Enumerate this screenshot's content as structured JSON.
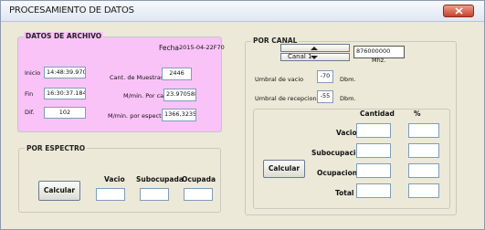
{
  "window": {
    "title": "PROCESAMIENTO DE DATOS"
  },
  "archivo": {
    "title": "DATOS DE ARCHIVO",
    "fecha_label": "Fecha",
    "fecha_value": "2015-04-22F70",
    "inicio_label": "Inicio",
    "inicio_value": "14:48:39.970",
    "fin_label": "Fin",
    "fin_value": "16:30:37.184",
    "dif_label": "Dif.",
    "dif_value": "102",
    "muestras_label": "Cant. de Muestras",
    "muestras_value": "2446",
    "mmin_canal_label": "M/min. Por canal",
    "mmin_canal_value": "23.970588",
    "mmin_espectro_label": "M/min. por espectro",
    "mmin_espectro_value": "1366,3235"
  },
  "espectro": {
    "title": "POR ESPECTRO",
    "calcular_label": "Calcular",
    "vacio_label": "Vacio",
    "subocupada_label": "Subocupada",
    "ocupada_label": "Ocupada",
    "vacio_value": "",
    "subocupada_value": "",
    "ocupada_value": ""
  },
  "canal": {
    "title": "POR CANAL",
    "canal_label": "Canal 1",
    "freq_value": "876000000",
    "freq_unit": "Mhz.",
    "umbral_vacio_label": "Umbral de vacio",
    "umbral_vacio_value": "-70",
    "umbral_vacio_unit": "Dbm.",
    "umbral_recepcion_label": "Umbral de recepcion",
    "umbral_recepcion_value": "-55",
    "umbral_recepcion_unit": "Dbm.",
    "calcular_label": "Calcular",
    "cantidad_header": "Cantidad",
    "percent_header": "%",
    "rows": [
      {
        "label": "Vacio",
        "cantidad": "",
        "percent": ""
      },
      {
        "label": "Subocupacion",
        "cantidad": "",
        "percent": ""
      },
      {
        "label": "Ocupacion",
        "cantidad": "",
        "percent": ""
      },
      {
        "label": "Total",
        "cantidad": "",
        "percent": ""
      }
    ]
  },
  "colors": {
    "archivo_panel_bg": "#f9c3f7",
    "window_bg": "#ece9d8",
    "close_button": "#c8412a"
  },
  "icons": {
    "close": "close-icon",
    "spin_up": "triangle-up-icon",
    "spin_down": "triangle-down-icon"
  }
}
